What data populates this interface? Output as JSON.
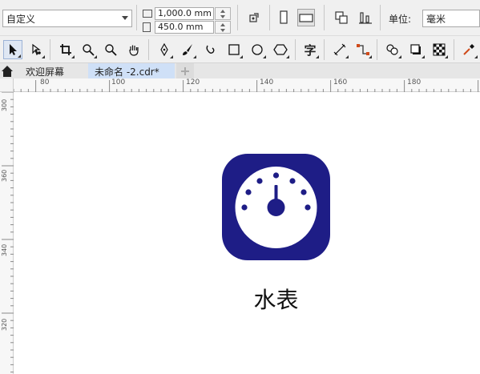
{
  "property_bar": {
    "preset_value": "自定义",
    "width_value": "1,000.0 mm",
    "height_value": "450.0 mm",
    "unit_label": "单位:",
    "unit_value": "毫米"
  },
  "tabs": [
    {
      "label": "欢迎屏幕"
    },
    {
      "label": "未命名 -2.cdr*"
    }
  ],
  "ruler": {
    "h_labels": [
      "80",
      "100",
      "120",
      "140",
      "160",
      "180"
    ],
    "v_labels": [
      "300",
      "360",
      "340",
      "320"
    ]
  },
  "canvas": {
    "icon_caption": "水表",
    "icon_color": "#1e1d86"
  },
  "toolbox": {
    "text_tool_glyph": "字"
  }
}
